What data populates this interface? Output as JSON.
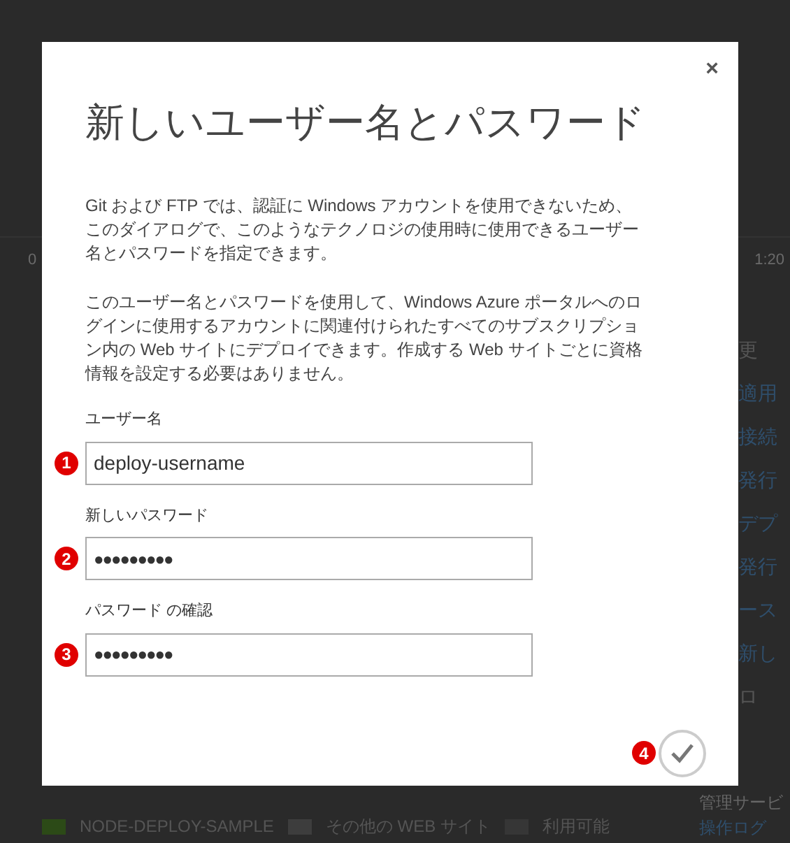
{
  "background": {
    "axis_labels": [
      "0",
      "1:20"
    ],
    "side_items": [
      {
        "text": "更",
        "kind": "label"
      },
      {
        "text": "適用",
        "kind": "link"
      },
      {
        "text": "接続",
        "kind": "link"
      },
      {
        "text": "発行",
        "kind": "link"
      },
      {
        "text": "デプ",
        "kind": "link"
      },
      {
        "text": "発行",
        "kind": "link"
      },
      {
        "text": "ース",
        "kind": "link"
      },
      {
        "text": "新し",
        "kind": "link"
      },
      {
        "text": "ロ",
        "kind": "label"
      }
    ],
    "section_title": "管理サービ",
    "section_link": "操作ログ",
    "legend": [
      {
        "label": "NODE-DEPLOY-SAMPLE",
        "color": "#2c4a17"
      },
      {
        "label": "その他の WEB サイト",
        "color": "#3d3d3d"
      },
      {
        "label": "利用可能",
        "color": "#363636"
      }
    ]
  },
  "dialog": {
    "close": "×",
    "title": "新しいユーザー名とパスワード",
    "paragraphs": [
      "Git および FTP では、認証に Windows アカウントを使用できないため、このダイアログで、このようなテクノロジの使用時に使用できるユーザー名とパスワードを指定できます。",
      "このユーザー名とパスワードを使用して、Windows Azure ポータルへのログインに使用するアカウントに関連付けられたすべてのサブスクリプション内の Web サイトにデプロイできます。作成する Web サイトごとに資格情報を設定する必要はありません。"
    ],
    "fields": [
      {
        "label": "ユーザー名",
        "value": "deploy-username",
        "kind": "text",
        "marker": "1"
      },
      {
        "label": "新しいパスワード",
        "value": "●●●●●●●●●",
        "kind": "password",
        "marker": "2"
      },
      {
        "label": "パスワード の確認",
        "value": "●●●●●●●●●",
        "kind": "password",
        "marker": "3"
      }
    ],
    "confirm_marker": "4"
  }
}
